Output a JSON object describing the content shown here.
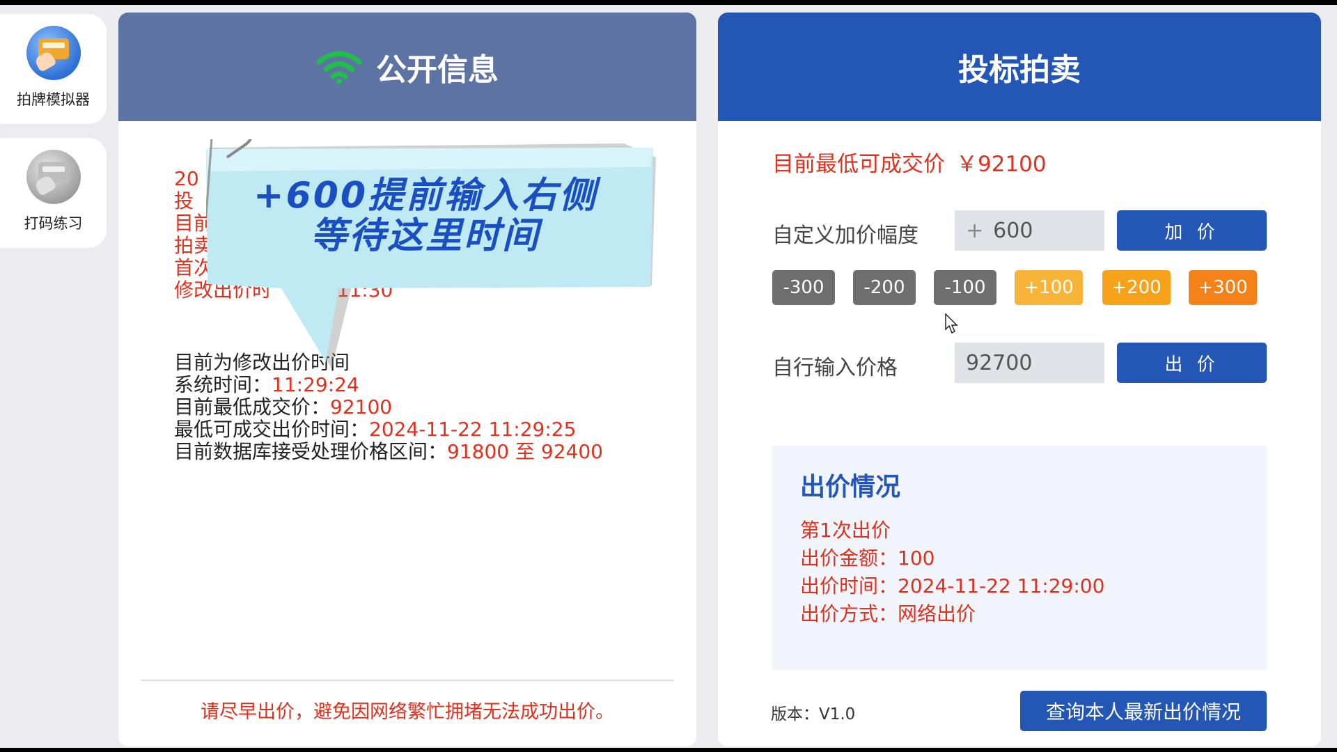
{
  "sidebar": {
    "items": [
      {
        "label": "拍牌模拟器",
        "icon": "auction-simulator-icon"
      },
      {
        "label": "打码练习",
        "icon": "typing-practice-icon"
      }
    ]
  },
  "left_panel": {
    "title": "公开信息",
    "title_icon": "wifi-icon",
    "info_lines": [
      "20",
      "投",
      "目前",
      "拍卖",
      "首次",
      "修改出价时",
      "00至11:30"
    ],
    "status": {
      "phase": "目前为修改出价时间",
      "system_time_label": "系统时间：",
      "system_time": "11:29:24",
      "lowest_price_label": "目前最低成交价：",
      "lowest_price": "92100",
      "lowest_time_label": "最低可成交出价时间：",
      "lowest_time": "2024-11-22 11:29:25",
      "range_label": "目前数据库接受处理价格区间：",
      "range": "91800 至 92400"
    },
    "warning": "请尽早出价，避免因网络繁忙拥堵无法成功出价。"
  },
  "callout": {
    "line1": "+600提前输入右侧",
    "line2": "等待这里时间"
  },
  "right_panel": {
    "title": "投标拍卖",
    "lowest_deal_label": "目前最低可成交价",
    "lowest_deal_value": "￥92100",
    "custom_increment_label": "自定义加价幅度",
    "custom_increment_prefix": "+",
    "custom_increment_value": "600",
    "add_price_button": "加 价",
    "steps": [
      "-300",
      "-200",
      "-100",
      "+100",
      "+200",
      "+300"
    ],
    "step_colors": [
      "#6e6e6e",
      "#6e6e6e",
      "#6e6e6e",
      "#f8b439",
      "#f7a21b",
      "#f58218"
    ],
    "manual_price_label": "自行输入价格",
    "manual_price_value": "92700",
    "bid_button": "出 价",
    "bid_status": {
      "title": "出价情况",
      "count": "第1次出价",
      "amount_label": "出价金额：",
      "amount": "100",
      "time_label": "出价时间：",
      "time": "2024-11-22 11:29:00",
      "method_label": "出价方式：",
      "method": "网络出价"
    },
    "version_label": "版本：",
    "version": "V1.0",
    "query_button": "查询本人最新出价情况"
  },
  "colors": {
    "left_header": "#5d73a3",
    "right_header": "#2456b5",
    "accent_red": "#e0301e",
    "wifi_green": "#1fbf4a",
    "callout_fill": "#bfeaf3",
    "callout_text": "#1a4fc4"
  }
}
